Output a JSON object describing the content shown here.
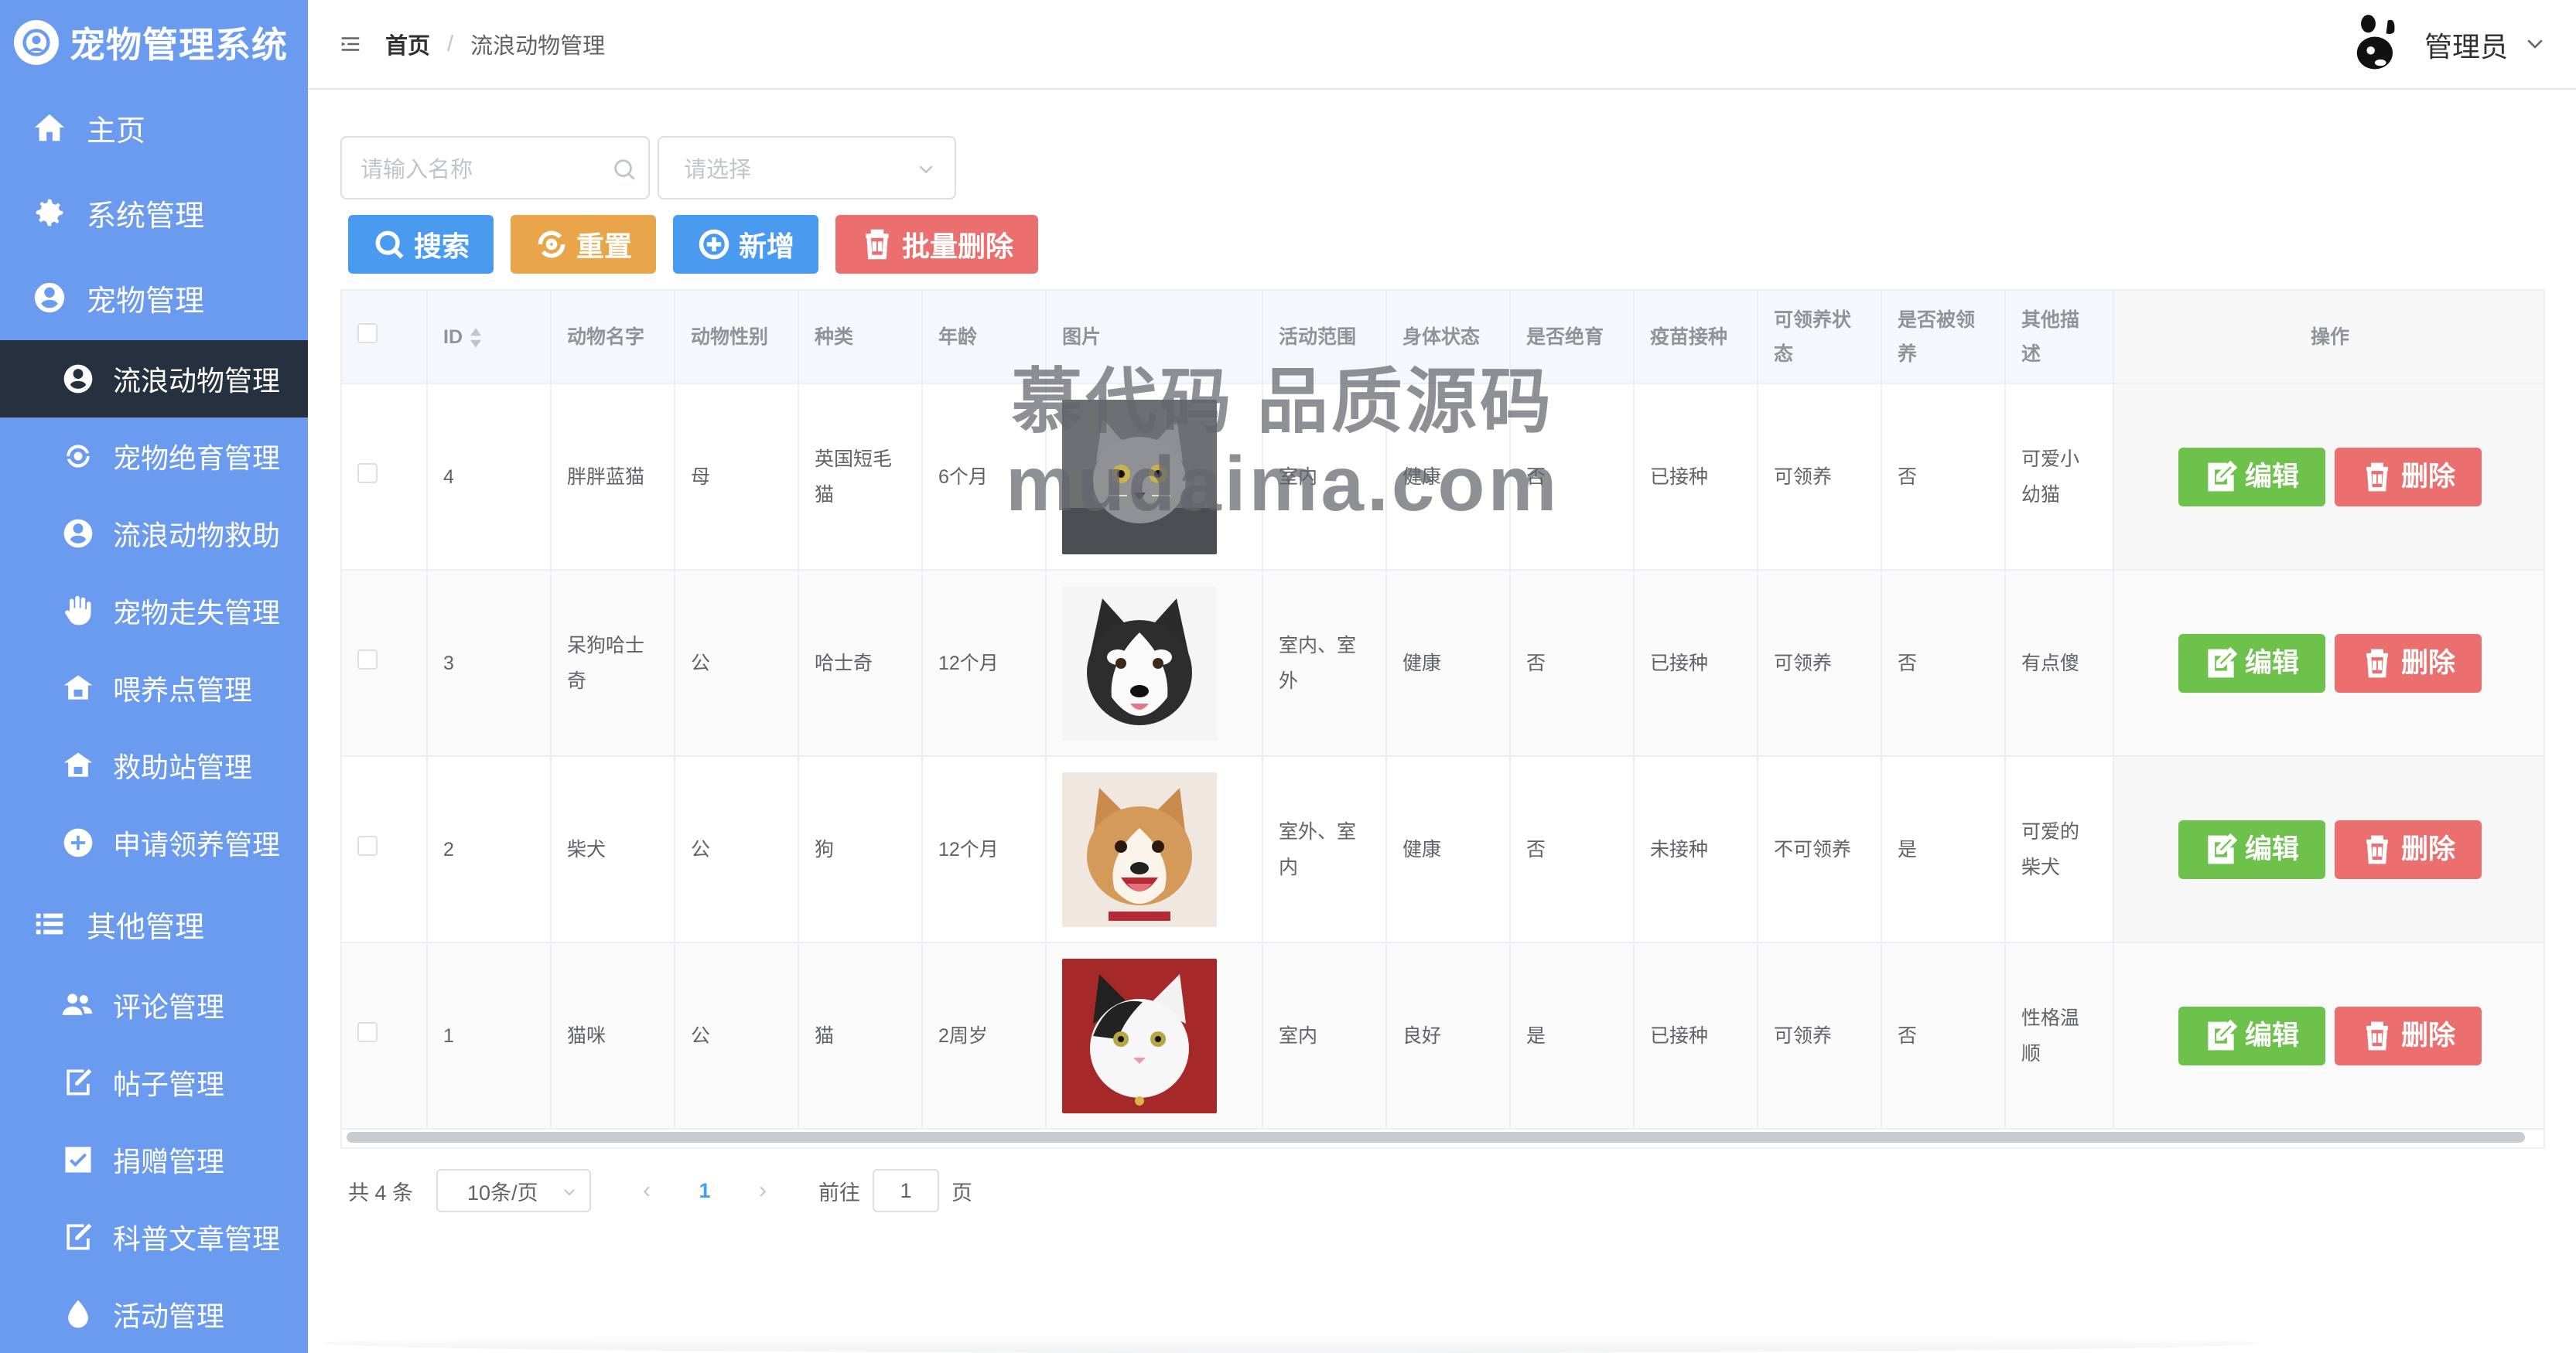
{
  "brand": {
    "title": "宠物管理系统"
  },
  "sidebar": {
    "items": [
      {
        "label": "主页",
        "icon": "home-icon"
      },
      {
        "label": "系统管理",
        "icon": "gear-icon"
      },
      {
        "label": "宠物管理",
        "icon": "pet-icon"
      }
    ],
    "pet_sub": [
      {
        "label": "流浪动物管理",
        "icon": "pet-icon",
        "active": true
      },
      {
        "label": "宠物绝育管理",
        "icon": "refresh-icon"
      },
      {
        "label": "流浪动物救助",
        "icon": "pet-icon"
      },
      {
        "label": "宠物走失管理",
        "icon": "hand-icon"
      },
      {
        "label": "喂养点管理",
        "icon": "house-icon"
      },
      {
        "label": "救助站管理",
        "icon": "house-icon"
      },
      {
        "label": "申请领养管理",
        "icon": "add-circle-icon"
      }
    ],
    "other": {
      "label": "其他管理",
      "icon": "list-icon"
    },
    "other_sub": [
      {
        "label": "评论管理",
        "icon": "users-icon"
      },
      {
        "label": "帖子管理",
        "icon": "edit-icon"
      },
      {
        "label": "捐赠管理",
        "icon": "check-icon"
      },
      {
        "label": "科普文章管理",
        "icon": "edit-icon"
      },
      {
        "label": "活动管理",
        "icon": "drop-icon"
      }
    ]
  },
  "header": {
    "breadcrumb_home": "首页",
    "breadcrumb_sep": "/",
    "breadcrumb_current": "流浪动物管理",
    "user_name": "管理员"
  },
  "filters": {
    "name_placeholder": "请输入名称",
    "select_placeholder": "请选择"
  },
  "toolbar": {
    "search_label": "搜索",
    "reset_label": "重置",
    "add_label": "新增",
    "batch_delete_label": "批量删除"
  },
  "table": {
    "columns": [
      "ID",
      "动物名字",
      "动物性别",
      "种类",
      "年龄",
      "图片",
      "活动范围",
      "身体状态",
      "是否绝育",
      "疫苗接种",
      "可领养状态",
      "是否被领养",
      "其他描述",
      "操作"
    ],
    "rows": [
      {
        "id": "4",
        "name": "胖胖蓝猫",
        "gender": "母",
        "species": "英国短毛猫",
        "age": "6个月",
        "image": "gray-cat",
        "range": "室内",
        "health": "健康",
        "neutered": "否",
        "vaccine": "已接种",
        "adoptable": "可领养",
        "adopted": "否",
        "desc": "可爱小幼猫"
      },
      {
        "id": "3",
        "name": "呆狗哈士奇",
        "gender": "公",
        "species": "哈士奇",
        "age": "12个月",
        "image": "husky",
        "range": "室内、室外",
        "health": "健康",
        "neutered": "否",
        "vaccine": "已接种",
        "adoptable": "可领养",
        "adopted": "否",
        "desc": "有点傻"
      },
      {
        "id": "2",
        "name": "柴犬",
        "gender": "公",
        "species": "狗",
        "age": "12个月",
        "image": "shiba",
        "range": "室外、室内",
        "health": "健康",
        "neutered": "否",
        "vaccine": "未接种",
        "adoptable": "不可领养",
        "adopted": "是",
        "desc": "可爱的柴犬"
      },
      {
        "id": "1",
        "name": "猫咪",
        "gender": "公",
        "species": "猫",
        "age": "2周岁",
        "image": "white-cat",
        "range": "室内",
        "health": "良好",
        "neutered": "是",
        "vaccine": "已接种",
        "adoptable": "可领养",
        "adopted": "否",
        "desc": "性格温顺"
      }
    ],
    "edit_label": "编辑",
    "delete_label": "删除"
  },
  "pagination": {
    "total": "共 4 条",
    "page_size": "10条/页",
    "current_page": "1",
    "goto_label": "前往",
    "goto_value": "1",
    "page_suffix": "页"
  },
  "watermark": {
    "line1": "慕代码 品质源码",
    "line2": "mudaima.com"
  },
  "colors": {
    "sidebar": "#6b9bef",
    "active": "#27303f",
    "primary": "#4a9bf0",
    "warning": "#e8a54a",
    "danger": "#eb6f6f",
    "success": "#6cc24a"
  }
}
